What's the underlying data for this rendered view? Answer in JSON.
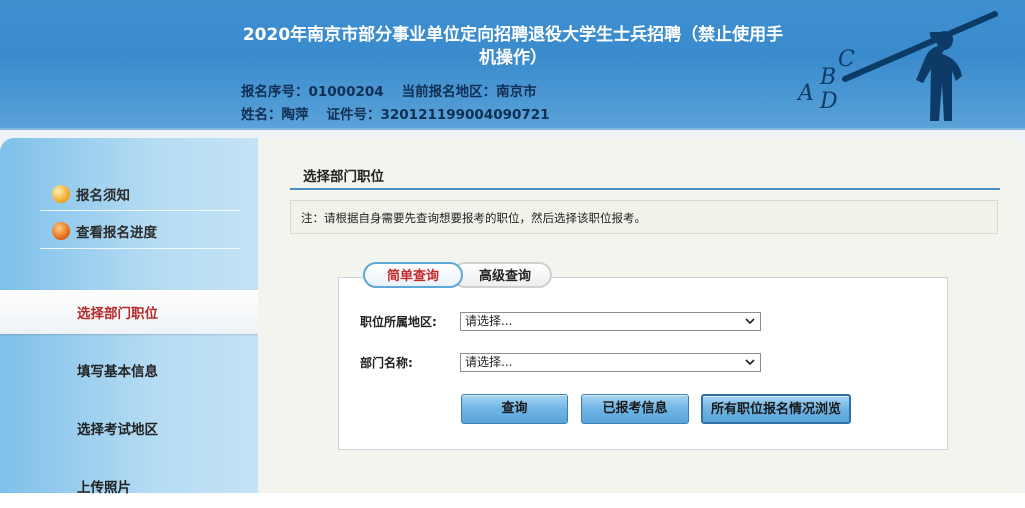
{
  "header": {
    "title": "2020年南京市部分事业单位定向招聘退役大学生士兵招聘（禁止使用手机操作）",
    "reg_no_label": "报名序号：",
    "reg_no": "01000204",
    "region_label": "当前报名地区：",
    "region": "南京市",
    "name_label": "姓名：",
    "name": "陶萍",
    "id_label": "证件号：",
    "id": "320121199004090721",
    "logo_letters": [
      "A",
      "B",
      "C",
      "D"
    ]
  },
  "sidebar": {
    "top_items": [
      {
        "label": "报名须知",
        "icon": "pencil-icon"
      },
      {
        "label": "查看报名进度",
        "icon": "progress-icon"
      }
    ],
    "steps": [
      {
        "label": "选择部门职位",
        "active": true
      },
      {
        "label": "填写基本信息",
        "active": false
      },
      {
        "label": "选择考试地区",
        "active": false
      },
      {
        "label": "上传照片",
        "active": false
      }
    ]
  },
  "main": {
    "section_title": "选择部门职位",
    "notice": "注：请根据自身需要先查询想要报考的职位，然后选择该职位报考。",
    "tabs": [
      {
        "label": "简单查询",
        "active": true
      },
      {
        "label": "高级查询",
        "active": false
      }
    ],
    "form": {
      "region_label": "职位所属地区:",
      "region_value": "请选择...",
      "dept_label": "部门名称:",
      "dept_value": "请选择..."
    },
    "buttons": {
      "query": "查询",
      "applied": "已报考信息",
      "all": "所有职位报名情况浏览"
    }
  },
  "colors": {
    "header_blue": "#3e8fd0",
    "active_step_text": "#b32a2a",
    "active_tab_text": "#c62828",
    "button_blue": "#6fb4e4"
  }
}
